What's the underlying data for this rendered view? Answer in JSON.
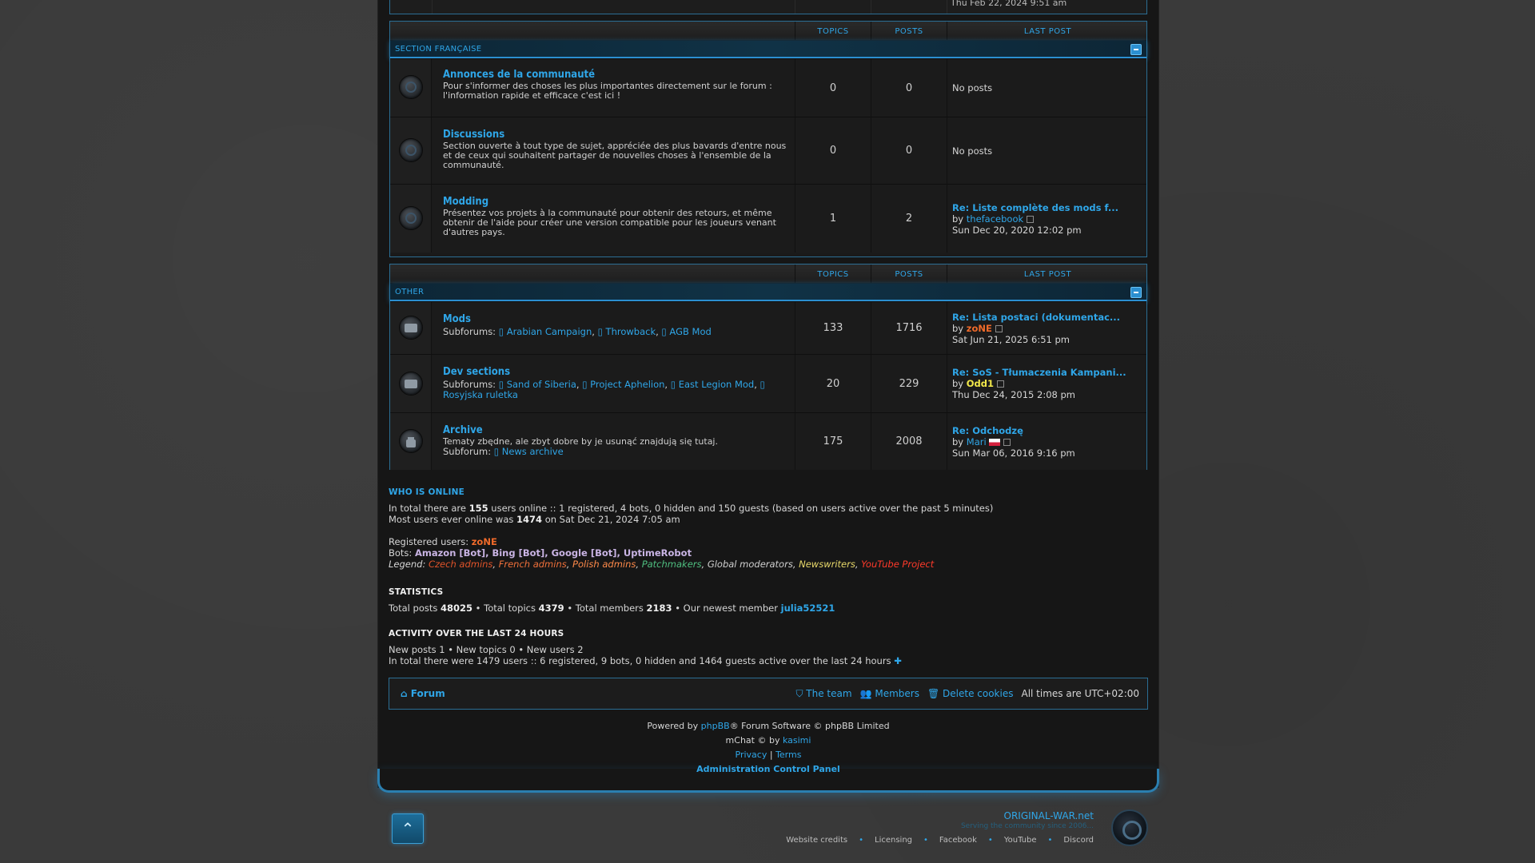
{
  "top_stub": {
    "last_post_time": "Thu Feb 22, 2024 9:51 am"
  },
  "sections": [
    {
      "title": "SECTION FRANÇAISE",
      "headers": {
        "topics": "TOPICS",
        "posts": "POSTS",
        "last_post": "LAST POST"
      },
      "forums": [
        {
          "name": "Annonces de la communauté",
          "desc": "Pour s'informer des choses les plus importantes directement sur le forum : l'information rapide et efficace c'est ici !",
          "topics": "0",
          "posts": "0",
          "last": "No posts"
        },
        {
          "name": "Discussions",
          "desc": "Section ouverte à tout type de sujet, appréciée des plus bavards d'entre nous et de ceux qui souhaitent partager de nouvelles choses à l'ensemble de la communauté.",
          "topics": "0",
          "posts": "0",
          "last": "No posts"
        },
        {
          "name": "Modding",
          "desc": "Présentez vos projets à la communauté pour obtenir des retours, et même obtenir de l'aide pour créer une version compatible pour les joueurs venant d'autres pays.",
          "topics": "1",
          "posts": "2",
          "last_title": "Re: Liste complète des mods f...",
          "last_by_label": "by",
          "last_author": "thefacebook",
          "last_date": "Sun Dec 20, 2020 12:02 pm"
        }
      ]
    },
    {
      "title": "OTHER",
      "headers": {
        "topics": "TOPICS",
        "posts": "POSTS",
        "last_post": "LAST POST"
      },
      "forums": [
        {
          "name": "Mods",
          "sub_label": "Subforums:",
          "subs": [
            "Arabian Campaign",
            "Throwback",
            "AGB Mod"
          ],
          "topics": "133",
          "posts": "1716",
          "last_title": "Re: Lista postaci (dokumentac...",
          "last_by_label": "by",
          "last_author": "zoNE",
          "last_date": "Sat Jun 21, 2025 6:51 pm"
        },
        {
          "name": "Dev sections",
          "sub_label": "Subforums:",
          "subs": [
            "Sand of Siberia",
            "Project Aphelion",
            "East Legion Mod",
            "Rosyjska ruletka"
          ],
          "topics": "20",
          "posts": "229",
          "last_title": "Re: SoS - Tłumaczenia Kampani...",
          "last_by_label": "by",
          "last_author": "Odd1",
          "last_date": "Thu Dec 24, 2015 2:08 pm"
        },
        {
          "name": "Archive",
          "desc": "Tematy zbędne, ale zbyt dobre by je usunąć znajdują się tutaj.",
          "sub_label": "Subforum:",
          "subs": [
            "News archive"
          ],
          "topics": "175",
          "posts": "2008",
          "last_title": "Re: Odchodzę",
          "last_by_label": "by",
          "last_author": "Mari",
          "last_date": "Sun Mar 06, 2016 9:16 pm"
        }
      ]
    }
  ],
  "who_online": {
    "title": "WHO IS ONLINE",
    "line1_a": "In total there are ",
    "line1_count": "155",
    "line1_b": " users online :: 1 registered, 4 bots, 0 hidden and 150 guests (based on users active over the past 5 minutes)",
    "line2_a": "Most users ever online was ",
    "line2_count": "1474",
    "line2_b": " on Sat Dec 21, 2024 7:05 am",
    "registered_label": "Registered users:",
    "registered_user": "zoNE",
    "bots_label": "Bots:",
    "bots": "Amazon [Bot], Bing [Bot], Google [Bot], UptimeRobot",
    "legend_label": "Legend:",
    "legend": [
      "Czech admins",
      "French admins",
      "Polish admins",
      "Patchmakers",
      "Global moderators",
      "Newswriters",
      "YouTube Project"
    ]
  },
  "statistics": {
    "title": "STATISTICS",
    "posts_label": "Total posts",
    "posts": "48025",
    "topics_label": "Total topics",
    "topics": "4379",
    "members_label": "Total members",
    "members": "2183",
    "newest_label": "Our newest member",
    "newest": "julia52521"
  },
  "activity": {
    "title": "ACTIVITY OVER THE LAST 24 HOURS",
    "line1": "New posts 1 • New topics 0 • New users 2",
    "line2": "In total there were 1479 users :: 6 registered, 9 bots, 0 hidden and 1464 guests active over the last 24 hours"
  },
  "navbar": {
    "forum": "Forum",
    "team": "The team",
    "members": "Members",
    "delete_cookies": "Delete cookies",
    "timezone": "All times are UTC+02:00"
  },
  "copyright": {
    "powered_a": "Powered by ",
    "phpbb": "phpBB",
    "powered_b": "® Forum Software © phpBB Limited",
    "mchat_a": "mChat © by ",
    "mchat_author": "kasimi",
    "privacy": "Privacy",
    "sep": " | ",
    "terms": "Terms",
    "acp": "Administration Control Panel"
  },
  "brand": {
    "name": "ORIGINAL-WAR.net",
    "tagline": "Serving the community since 2006..."
  },
  "footer_links": [
    "Website credits",
    "Licensing",
    "Facebook",
    "YouTube",
    "Discord"
  ],
  "colors": {
    "accent": "#2fa6e8",
    "border": "#2b6e94",
    "panel": "#1a1a1a"
  }
}
